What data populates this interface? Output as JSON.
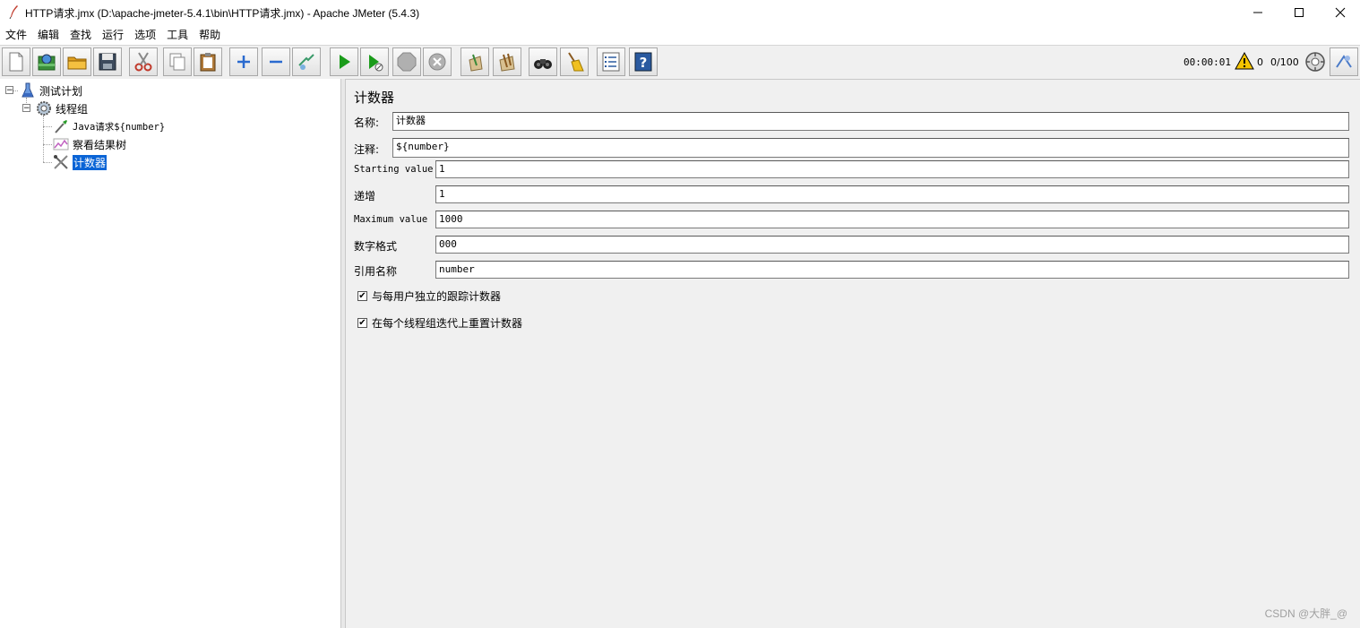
{
  "window": {
    "title": "HTTP请求.jmx (D:\\apache-jmeter-5.4.1\\bin\\HTTP请求.jmx) - Apache JMeter (5.4.3)",
    "minimize": "—",
    "maximize": "☐",
    "close": "✕"
  },
  "menu": [
    "文件",
    "编辑",
    "查找",
    "运行",
    "选项",
    "工具",
    "帮助"
  ],
  "toolbar": {
    "buttons": [
      "new-icon",
      "templates-icon",
      "open-icon",
      "save-icon",
      "cut-icon",
      "copy-icon",
      "paste-icon",
      "expand-icon",
      "collapse-icon",
      "toggle-icon",
      "start-icon",
      "start-no-pause-icon",
      "stop-icon",
      "shutdown-icon",
      "clear-icon",
      "clear-all-icon",
      "search-icon",
      "reset-search-icon",
      "function-helper-icon",
      "help-icon"
    ],
    "elapsed_time": "00:00:01",
    "warning_count": "0",
    "threads": "0/100"
  },
  "tree": {
    "test_plan": "测试计划",
    "thread_group": "线程组",
    "java_request": "Java请求${number}",
    "view_results": "察看结果树",
    "counter": "计数器"
  },
  "form": {
    "title": "计数器",
    "name_label": "名称:",
    "name_value": "计数器",
    "comment_label": "注释:",
    "comment_value": "${number}",
    "start_label": "Starting value",
    "start_value": "1",
    "increment_label": "递增",
    "increment_value": "1",
    "max_label": "Maximum value",
    "max_value": "1000",
    "format_label": "数字格式",
    "format_value": "000",
    "refname_label": "引用名称",
    "refname_value": "number",
    "per_user_label": "与每用户独立的跟踪计数器",
    "per_user_checked": true,
    "reset_label": "在每个线程组迭代上重置计数器",
    "reset_checked": true
  },
  "watermark": "CSDN @大胖_@",
  "colors": {
    "selection": "#0a64d6",
    "warning": "#f5c400",
    "start": "#1a9b1a"
  }
}
